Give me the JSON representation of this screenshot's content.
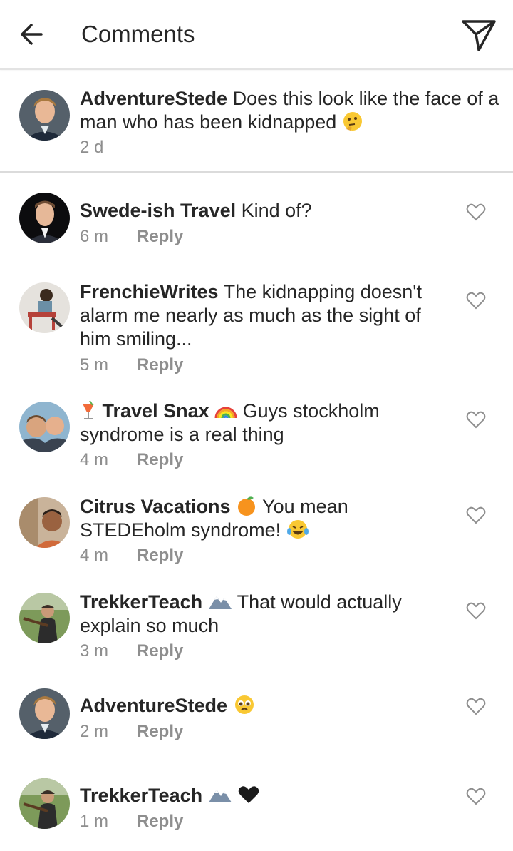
{
  "header": {
    "title": "Comments",
    "back_icon": "arrow-left-icon",
    "send_icon": "paper-plane-icon"
  },
  "caption": {
    "username": "AdventureStede",
    "text": "Does this look like the face of a man who has been kidnapped",
    "emoji": "thinking-face",
    "time": "2 d"
  },
  "comments": [
    {
      "username": "Swede-ish Travel",
      "text": "Kind of?",
      "time": "6 m",
      "reply": "Reply"
    },
    {
      "username": "FrenchieWrites",
      "text": "The kidnapping doesn't alarm me nearly as much as the sight of him smiling...",
      "time": "5 m",
      "reply": "Reply"
    },
    {
      "username": "Travel Snax",
      "text": "Guys stockholm syndrome is a real thing",
      "time": "4 m",
      "reply": "Reply",
      "emoji_before": "tropical-drink",
      "emoji_after": "rainbow"
    },
    {
      "username": "Citrus Vacations",
      "text": "You mean STEDEholm syndrome!",
      "time": "4 m",
      "reply": "Reply",
      "emoji_after": "tangerine",
      "emoji_end": "laughing-tears"
    },
    {
      "username": "TrekkerTeach",
      "text": "That would actually explain so much",
      "time": "3 m",
      "reply": "Reply",
      "emoji_after": "snow-mountain"
    },
    {
      "username": "AdventureStede",
      "text": "",
      "time": "2 m",
      "reply": "Reply",
      "emoji_after": "pleading-face"
    },
    {
      "username": "TrekkerTeach",
      "text": "",
      "time": "1 m",
      "reply": "Reply",
      "emoji_after": "snow-mountain",
      "emoji_end": "black-heart"
    }
  ],
  "colors": {
    "text": "#262626",
    "meta": "#8e8e8e",
    "divider": "#dbdbdb"
  }
}
